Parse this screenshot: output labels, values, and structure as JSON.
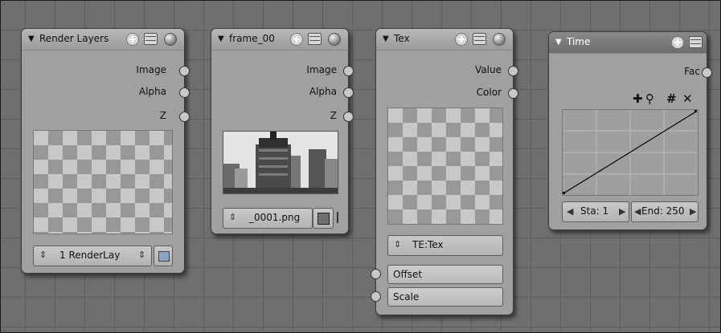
{
  "nodes": {
    "render_layers": {
      "title": "Render Layers",
      "outputs": [
        "Image",
        "Alpha",
        "Z"
      ],
      "layer_select": "1 RenderLay"
    },
    "frame": {
      "title": "frame_00",
      "outputs": [
        "Image",
        "Alpha",
        "Z"
      ],
      "file_field": "_0001.png"
    },
    "tex": {
      "title": "Tex",
      "outputs": [
        "Value",
        "Color"
      ],
      "texture_field": "TE:Tex",
      "inputs": [
        "Offset",
        "Scale"
      ]
    },
    "time": {
      "title": "Time",
      "outputs": [
        "Fac"
      ],
      "start_label": "Sta: 1",
      "end_label": "End: 250"
    }
  },
  "icons": [
    "plus-icon",
    "list-icon",
    "sphere-icon",
    "add-point-icon",
    "zoom-icon",
    "clip-icon",
    "delete-icon"
  ],
  "colors": {
    "background": "#6f6f6f",
    "node_body": "#a0a0a0",
    "selected_header": "#777777"
  }
}
